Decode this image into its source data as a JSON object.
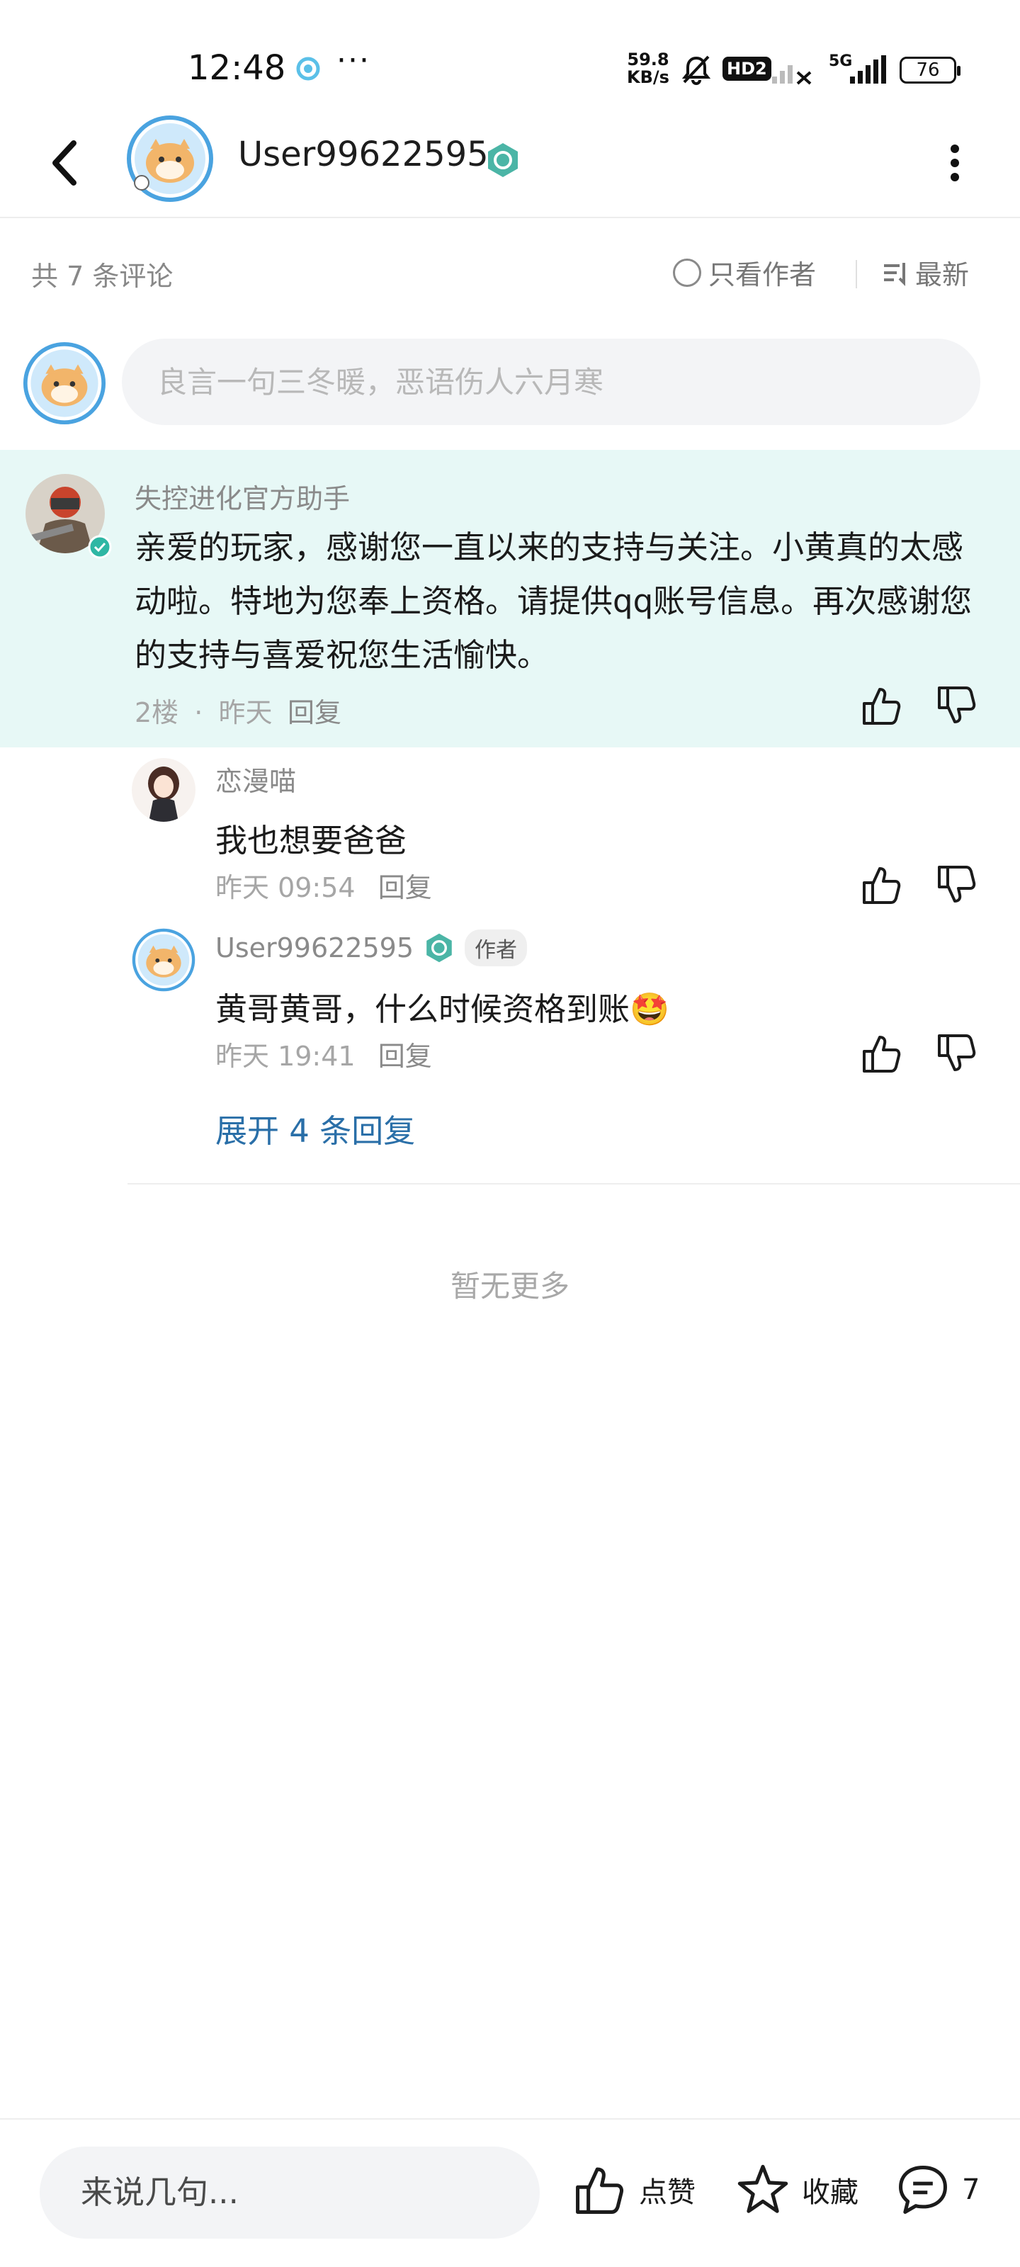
{
  "status_bar": {
    "time": "12:48",
    "more": "···",
    "net_speed_value": "59.8",
    "net_speed_unit": "KB/s",
    "hd_label": "HD2",
    "network_label": "5G",
    "battery": "76"
  },
  "header": {
    "username": "User99622595"
  },
  "comments_header": {
    "count_text": "共 7 条评论",
    "only_author_label": "只看作者",
    "sort_label": "最新"
  },
  "input": {
    "placeholder": "良言一句三冬暖，恶语伤人六月寒"
  },
  "main_comment": {
    "author": "失控进化官方助手",
    "text": "亲爱的玩家，感谢您一直以来的支持与关注。小黄真的太感动啦。特地为您奉上资格。请提供qq账号信息。再次感谢您的支持与喜爱祝您生活愉快。",
    "floor": "2楼",
    "dot": "·",
    "time": "昨天",
    "reply_label": "回复"
  },
  "replies": [
    {
      "author": "恋漫喵",
      "text": "我也想要爸爸",
      "time": "昨天 09:54",
      "reply_label": "回复"
    },
    {
      "author": "User99622595",
      "author_tag": "作者",
      "text": "黄哥黄哥，什么时候资格到账🤩",
      "time": "昨天 19:41",
      "reply_label": "回复"
    }
  ],
  "expand_label": "展开 4 条回复",
  "no_more_label": "暂无更多",
  "bottom_bar": {
    "input_placeholder": "来说几句...",
    "like_label": "点赞",
    "favorite_label": "收藏",
    "comment_count": "7"
  },
  "colors": {
    "accent_teal": "#2fb7a4",
    "highlight_bg": "#e7f8f6",
    "link_blue": "#2a6fa8"
  }
}
